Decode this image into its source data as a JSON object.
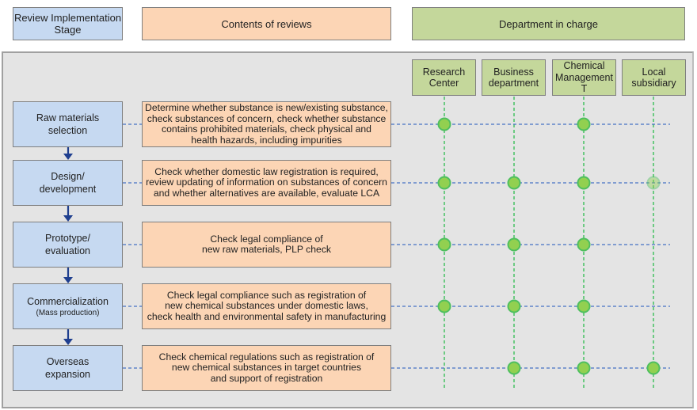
{
  "header": {
    "stage_label": "Review Implementation Stage",
    "contents_label": "Contents of reviews",
    "department_label": "Department in charge"
  },
  "departments": [
    {
      "label": "Research\nCenter"
    },
    {
      "label": "Business\ndepartment"
    },
    {
      "label": "Chemical\nManagement T"
    },
    {
      "label": "Local\nsubsidiary"
    }
  ],
  "stages": [
    {
      "label": "Raw materials\nselection",
      "sub": "",
      "content": "Determine whether substance is new/existing substance,\ncheck substances of concern, check whether substance\ncontains prohibited materials, check physical and\nhealth hazards, including impurities",
      "involved": [
        true,
        false,
        true,
        false
      ],
      "faded": [
        false,
        false,
        false,
        false
      ]
    },
    {
      "label": "Design/\ndevelopment",
      "sub": "",
      "content": "Check whether domestic law registration is required,\nreview updating of information on substances of concern\nand whether alternatives are available, evaluate LCA",
      "involved": [
        true,
        true,
        true,
        true
      ],
      "faded": [
        false,
        false,
        false,
        true
      ]
    },
    {
      "label": "Prototype/\nevaluation",
      "sub": "",
      "content": "Check legal compliance of\nnew raw materials, PLP check",
      "involved": [
        true,
        true,
        true,
        false
      ],
      "faded": [
        false,
        false,
        false,
        false
      ]
    },
    {
      "label": "Commercialization",
      "sub": "(Mass production)",
      "content": "Check legal compliance such as registration of\nnew chemical substances under domestic  laws,\ncheck health and environmental safety in manufacturing",
      "involved": [
        true,
        true,
        true,
        false
      ],
      "faded": [
        false,
        false,
        false,
        false
      ]
    },
    {
      "label": "Overseas\nexpansion",
      "sub": "",
      "content": "Check chemical regulations such as registration of\nnew chemical substances in target countries\nand support of registration",
      "involved": [
        false,
        true,
        true,
        true
      ],
      "faded": [
        false,
        false,
        false,
        false
      ]
    }
  ],
  "colors": {
    "stage_fill": "#c6d9f1",
    "content_fill": "#fcd5b5",
    "department_fill": "#c4d79b",
    "panel_fill": "#e4e4e4",
    "arrow": "#1f3f8f",
    "row_line": "#4472c4",
    "column_line": "#4fc36a",
    "dot_fill": "#92d050",
    "dot_stroke": "#4fbf5f"
  }
}
